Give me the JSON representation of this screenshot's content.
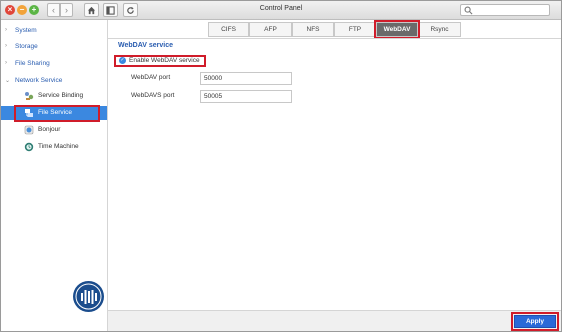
{
  "window": {
    "title": "Control Panel",
    "search_placeholder": ""
  },
  "toolbar": {
    "close_glyph": "×",
    "min_glyph": "−",
    "max_glyph": "+",
    "back_glyph": "‹",
    "forward_glyph": "›"
  },
  "sidebar": {
    "items": [
      {
        "label": "System"
      },
      {
        "label": "Storage"
      },
      {
        "label": "File Sharing"
      },
      {
        "label": "Network Service"
      }
    ],
    "subitems": [
      {
        "label": "Service Binding",
        "icon": "service-binding-icon"
      },
      {
        "label": "File Service",
        "icon": "file-service-icon"
      },
      {
        "label": "Bonjour",
        "icon": "bonjour-icon"
      },
      {
        "label": "Time Machine",
        "icon": "time-machine-icon"
      }
    ]
  },
  "tabs": [
    {
      "label": "CIFS"
    },
    {
      "label": "AFP"
    },
    {
      "label": "NFS"
    },
    {
      "label": "FTP"
    },
    {
      "label": "WebDAV"
    },
    {
      "label": "Rsync"
    }
  ],
  "webdav": {
    "section_title": "WebDAV service",
    "enable_label": "Enable WebDAV service",
    "enabled": true,
    "port_label": "WebDAV port",
    "port_value": "50000",
    "ssl_port_label": "WebDAVS port",
    "ssl_port_value": "50005"
  },
  "footer": {
    "apply_label": "Apply"
  },
  "colors": {
    "accent": "#3b88e0",
    "highlight": "#d01c2a",
    "apply": "#2a69d8"
  }
}
